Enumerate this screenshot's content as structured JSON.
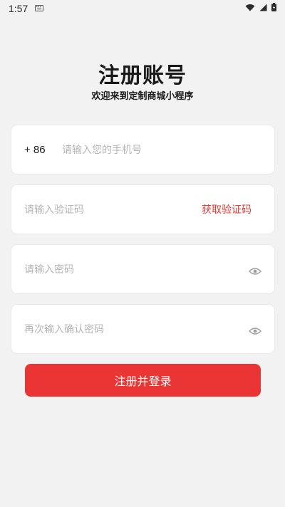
{
  "status_bar": {
    "time": "1:57",
    "icons": [
      "keyboard-icon",
      "wifi-icon",
      "signal-icon",
      "battery-icon"
    ]
  },
  "header": {
    "title": "注册账号",
    "subtitle": "欢迎来到定制商城小程序"
  },
  "form": {
    "phone": {
      "prefix": "+ 86",
      "placeholder": "请输入您的手机号"
    },
    "code": {
      "placeholder": "请输入验证码",
      "action_label": "获取验证码"
    },
    "password": {
      "placeholder": "请输入密码"
    },
    "confirm_password": {
      "placeholder": "再次输入确认密码"
    },
    "submit_label": "注册并登录"
  },
  "colors": {
    "accent": "#eb3434",
    "placeholder": "#b5b5b5",
    "background": "#f2f2f2"
  }
}
